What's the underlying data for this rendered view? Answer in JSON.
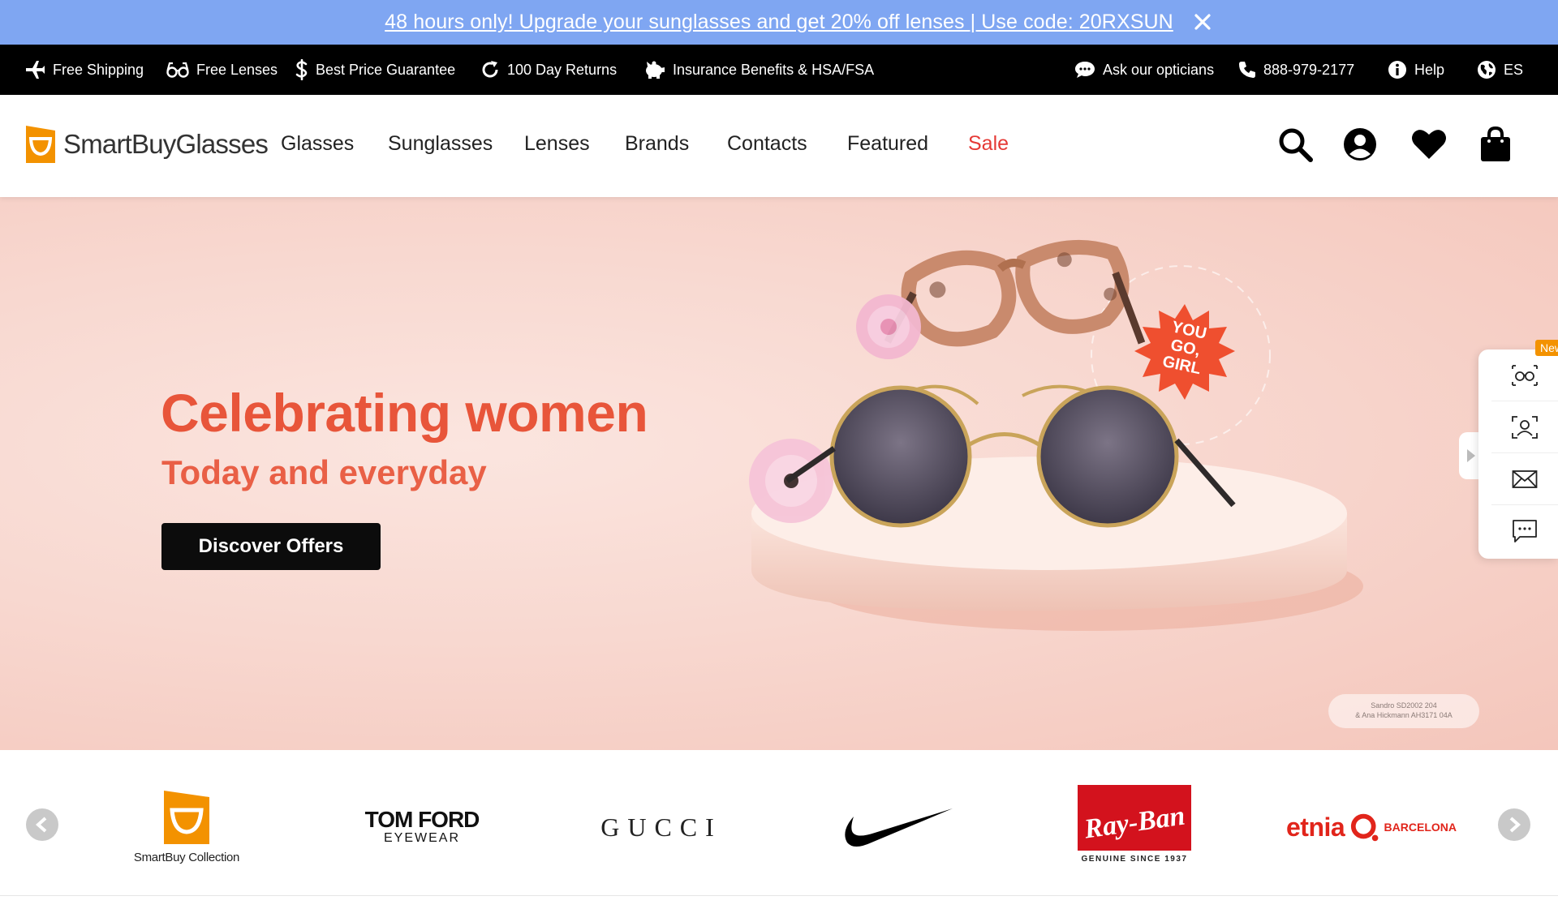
{
  "promo": {
    "text": "48 hours only! Upgrade your sunglasses and get 20% off lenses | Use code: 20RXSUN"
  },
  "utility": {
    "items": [
      {
        "label": "Free Shipping",
        "icon": "airplane-icon"
      },
      {
        "label": "Free Lenses",
        "icon": "glasses-icon"
      },
      {
        "label": "Best Price Guarantee",
        "icon": "dollar-icon"
      },
      {
        "label": "100 Day Returns",
        "icon": "refresh-icon"
      },
      {
        "label": "Insurance Benefits & HSA/FSA",
        "icon": "piggy-bank-icon"
      }
    ],
    "right": [
      {
        "label": "Ask our opticians",
        "icon": "chat-icon"
      },
      {
        "label": "888-979-2177",
        "icon": "phone-icon"
      },
      {
        "label": "Help",
        "icon": "info-icon"
      },
      {
        "label": "ES",
        "icon": "globe-icon"
      }
    ]
  },
  "header": {
    "logo_text": "SmartBuyGlasses",
    "nav": [
      "Glasses",
      "Sunglasses",
      "Lenses",
      "Brands",
      "Contacts",
      "Featured",
      "Sale"
    ],
    "icons": [
      "search-icon",
      "account-icon",
      "wishlist-heart-icon",
      "shopping-bag-icon"
    ]
  },
  "hero": {
    "title": "Celebrating women",
    "subtitle": "Today and everyday",
    "cta": "Discover Offers",
    "sticker": [
      "YOU",
      "GO,",
      "GIRL"
    ],
    "credit_line1": "Sandro SD2002 204",
    "credit_line2": "& Ana Hickmann AH3171 04A"
  },
  "side_widget": {
    "badge": "New",
    "buttons": [
      "virtual-try-on-icon",
      "face-scan-icon",
      "email-icon",
      "chat-bubble-icon"
    ]
  },
  "brands": {
    "items": [
      {
        "name": "SmartBuy Collection",
        "caption": "SmartBuy Collection"
      },
      {
        "name": "Tom Ford Eyewear",
        "line1": "TOM FORD",
        "line2": "EYEWEAR"
      },
      {
        "name": "Gucci",
        "line1": "GUCCI"
      },
      {
        "name": "Nike"
      },
      {
        "name": "Ray-Ban",
        "line1": "Ray-Ban",
        "line2": "GENUINE SINCE 1937"
      },
      {
        "name": "Etnia Barcelona",
        "line1": "etnia",
        "line2": "BARCELONA"
      }
    ]
  },
  "colors": {
    "promo_bg": "#7fa6f2",
    "accent_orange": "#f39200",
    "hero_text": "#e8553a",
    "sale_red": "#e53935",
    "rayban_red": "#d3121d",
    "etnia_red": "#e1251b"
  }
}
